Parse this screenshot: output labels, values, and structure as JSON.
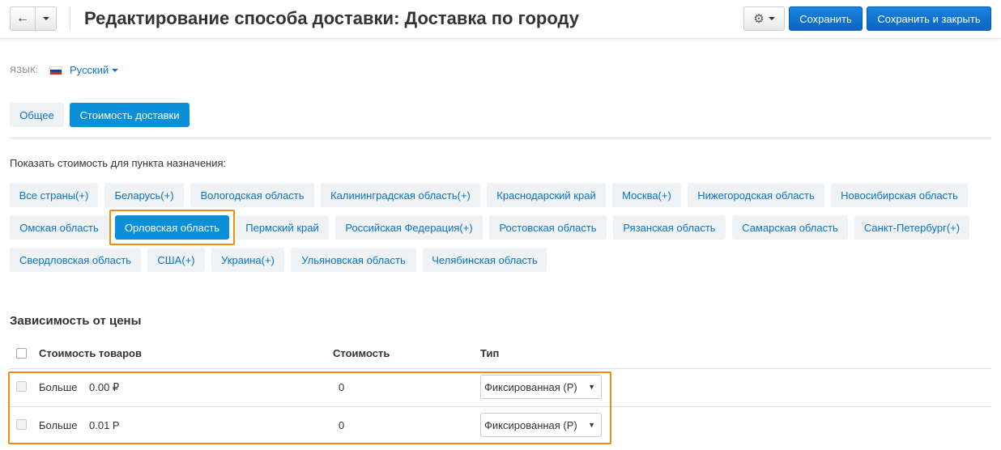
{
  "header": {
    "back_icon": "←",
    "title": "Редактирование способа доставки: Доставка по городу",
    "gear_icon": "⚙",
    "save_label": "Сохранить",
    "save_close_label": "Сохранить и закрыть"
  },
  "language": {
    "label": "ЯЗЫК:",
    "current": "Русский",
    "flag_colors": [
      "#ffffff",
      "#1c3faa",
      "#d52b1e"
    ]
  },
  "tabs": [
    {
      "label": "Общее",
      "active": false
    },
    {
      "label": "Стоимость доставки",
      "active": true
    }
  ],
  "destinations": {
    "label": "Показать стоимость для пункта назначения:",
    "items": [
      {
        "label": "Все страны(+)",
        "active": false
      },
      {
        "label": "Беларусь(+)",
        "active": false
      },
      {
        "label": "Вологодская область",
        "active": false
      },
      {
        "label": "Калининградская область(+)",
        "active": false
      },
      {
        "label": "Краснодарский край",
        "active": false
      },
      {
        "label": "Москва(+)",
        "active": false
      },
      {
        "label": "Нижегородская область",
        "active": false
      },
      {
        "label": "Новосибирская область",
        "active": false
      },
      {
        "label": "Омская область",
        "active": false
      },
      {
        "label": "Орловская область",
        "active": true
      },
      {
        "label": "Пермский край",
        "active": false
      },
      {
        "label": "Российская Федерация(+)",
        "active": false
      },
      {
        "label": "Ростовская область",
        "active": false
      },
      {
        "label": "Рязанская область",
        "active": false
      },
      {
        "label": "Самарская область",
        "active": false
      },
      {
        "label": "Санкт-Петербург(+)",
        "active": false
      },
      {
        "label": "Свердловская область",
        "active": false
      },
      {
        "label": "США(+)",
        "active": false
      },
      {
        "label": "Украина(+)",
        "active": false
      },
      {
        "label": "Ульяновская область",
        "active": false
      },
      {
        "label": "Челябинская область",
        "active": false
      }
    ]
  },
  "price_dependency": {
    "title": "Зависимость от цены",
    "columns": [
      "Стоимость товаров",
      "Стоимость",
      "Тип"
    ],
    "rows": [
      {
        "condition": "Больше",
        "amount": "0.00 ₽",
        "cost": "0",
        "type": "Фиксированная (Р)"
      },
      {
        "condition": "Больше",
        "amount": "0.01 Р",
        "cost": "0",
        "type": "Фиксированная (Р)"
      }
    ]
  },
  "colors": {
    "accent": "#0b8fd8",
    "link": "#0b72c4",
    "highlight": "#ef8c12"
  }
}
